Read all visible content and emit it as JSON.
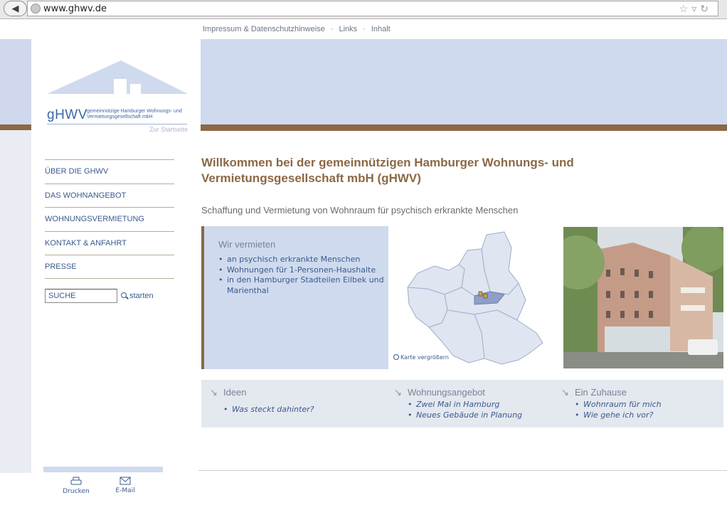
{
  "browser": {
    "url": "www.ghwv.de"
  },
  "top_links": [
    "Impressum & Datenschutzhinweise",
    "Links",
    "Inhalt"
  ],
  "top_links_separator": "·",
  "logo": {
    "brand": "gHWV",
    "full_name": "gemeinnützige Hamburger Wohnungs- und Vermietungsgesellschaft mbH",
    "home_link": "Zur Startseite"
  },
  "nav": {
    "items": [
      "ÜBER DIE GHWV",
      "DAS WOHNANGEBOT",
      "WOHNUNGSVERMIETUNG",
      "KONTAKT & ANFAHRT",
      "PRESSE"
    ]
  },
  "search": {
    "value": "SUCHE",
    "button_label": "starten"
  },
  "footer_tools": {
    "print_label": "Drucken",
    "email_label": "E-Mail"
  },
  "main": {
    "headline": "Willkommen bei der gemeinnützigen Hamburger Wohnungs- und Vermietungsgesellschaft mbH (gHWV)",
    "subline": "Schaffung und Vermietung von Wohnraum für psychisch erkrankte Menschen",
    "rent_box": {
      "title": "Wir vermieten",
      "items": [
        "an psychisch erkrankte Menschen",
        "Wohnungen für 1-Personen-Haushalte",
        "in den Hamburger Stadteilen Eilbek und Marienthal"
      ]
    },
    "map_link": "Karte vergrößern",
    "info": [
      {
        "title": "Ideen",
        "items": [
          "Was steckt dahinter?"
        ]
      },
      {
        "title": "Wohnungsangebot",
        "items": [
          "Zwei Mal in Hamburg",
          "Neues Gebäude in Planung"
        ]
      },
      {
        "title": "Ein Zuhause",
        "items": [
          "Wohnraum für mich",
          "Wie gehe ich vor?"
        ]
      }
    ]
  },
  "colors": {
    "accent_brown": "#8c6845",
    "light_blue": "#cfdaee",
    "link_blue": "#3a5a8c"
  }
}
